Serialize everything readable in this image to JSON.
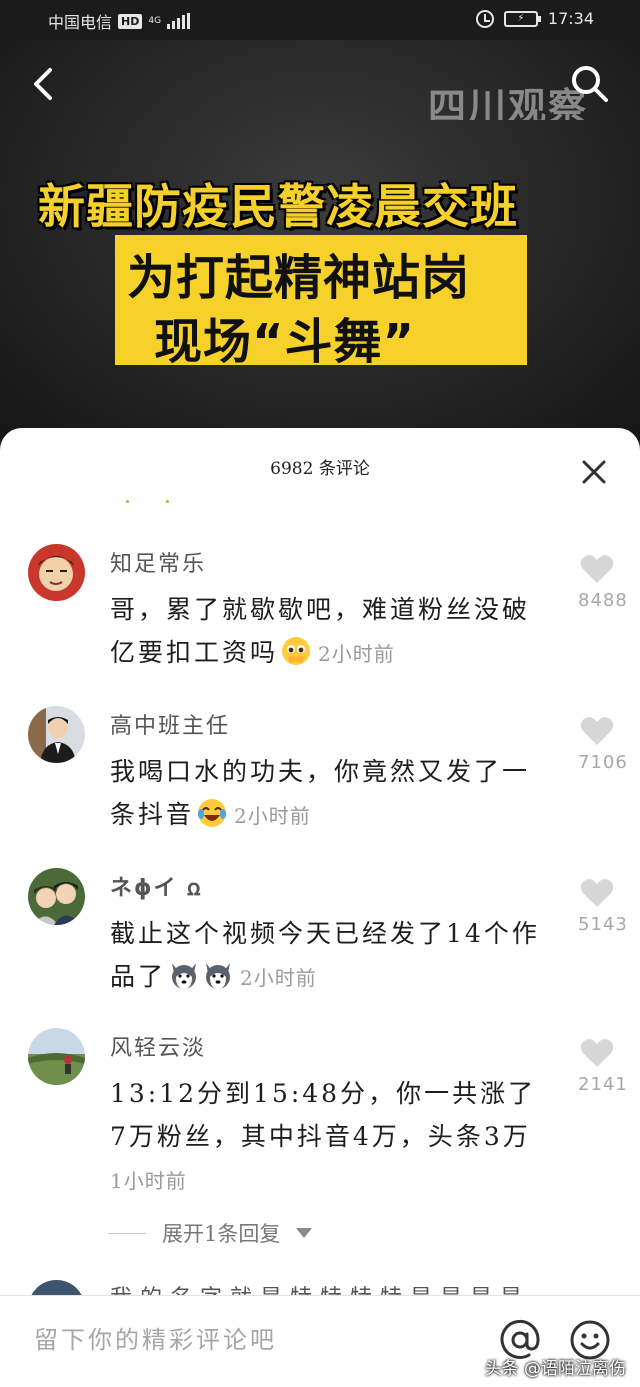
{
  "status_bar": {
    "carrier": "中国电信",
    "hd": "HD",
    "network": "4G",
    "battery_icon": "battery-charging-icon",
    "alarm_icon": "alarm-icon",
    "time": "17:34"
  },
  "video": {
    "back_icon": "back-arrow-icon",
    "search_icon": "search-icon",
    "watermark": "四川观察",
    "headline": "新疆防疫民警凌晨交班",
    "subtitle_line1": "为打起精神站岗",
    "subtitle_line2": "现场“斗舞”",
    "colors": {
      "headline": "#f5d02a",
      "subtitle_bg": "#f5d12a"
    }
  },
  "comments_panel": {
    "title": "6982 条评论",
    "close_icon": "close-icon",
    "comments": [
      {
        "name": "知足常乐",
        "text": "哥，累了就歇歇吧，难道粉丝没破亿要扣工资吗",
        "emoji": "pleading-face-emoji",
        "time": "2小时前",
        "likes": "8488"
      },
      {
        "name": "高中班主任",
        "text": "我喝口水的功夫，你竟然又发了一条抖音",
        "emoji": "laughing-crying-emoji",
        "time": "2小时前",
        "likes": "7106"
      },
      {
        "name": "ネɸイ ꭥ",
        "text": "截止这个视频今天已经发了14个作品了",
        "emoji": "husky-dog-emoji",
        "time": "2小时前",
        "likes": "5143"
      },
      {
        "name": "风轻云淡",
        "text": "13:12分到15:48分，你一共涨了7万粉丝，其中抖音4万，头条3万",
        "time": "1小时前",
        "likes": "2141"
      }
    ],
    "expand_replies": "展开1条回复",
    "partial_name": "我的名字就是特特特特是是是是"
  },
  "input_bar": {
    "placeholder": "留下你的精彩评论吧",
    "at_icon": "at-icon",
    "emoji_icon": "smiley-icon",
    "source_watermark": "头条 @语陌泣离伤"
  }
}
